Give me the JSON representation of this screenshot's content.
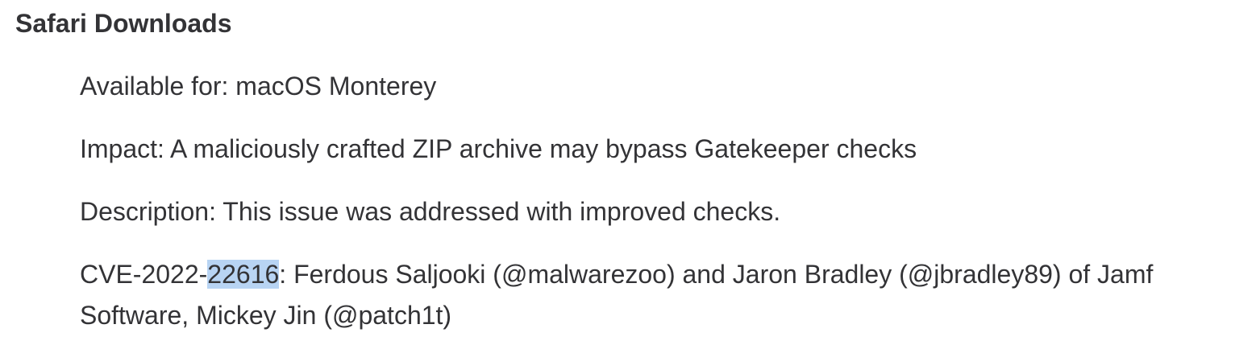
{
  "section": {
    "title": "Safari Downloads",
    "available": "Available for: macOS Monterey",
    "impact": "Impact: A maliciously crafted ZIP archive may bypass Gatekeeper checks",
    "description": "Description: This issue was addressed with improved checks.",
    "cve": {
      "prefix": "CVE-2022-",
      "number": "22616",
      "credit": ": Ferdous Saljooki (@malwarezoo) and Jaron Bradley (@jbradley89) of Jamf Software, Mickey Jin (@patch1t)"
    }
  },
  "colors": {
    "text": "#333336",
    "selection": "#b8d4f3"
  }
}
